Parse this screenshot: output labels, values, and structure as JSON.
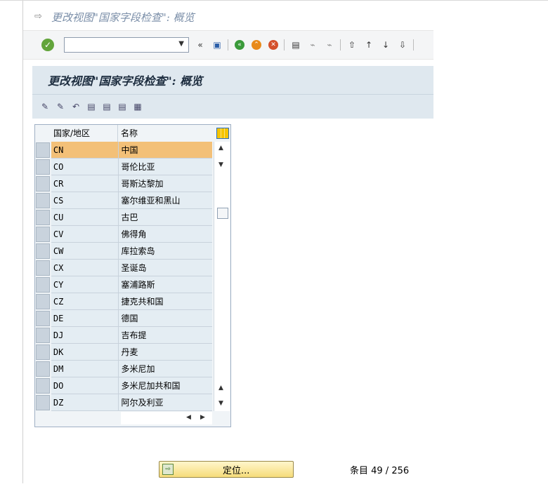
{
  "window": {
    "title": "更改视图\"国家字段检查\": 概览"
  },
  "toolbar": {
    "command_value": ""
  },
  "header": {
    "title": "更改视图\"国家字段检查\": 概览"
  },
  "table": {
    "columns": [
      "国家/地区",
      "名称"
    ],
    "rows": [
      {
        "code": "CN",
        "name": "中国"
      },
      {
        "code": "CO",
        "name": "哥伦比亚"
      },
      {
        "code": "CR",
        "name": "哥斯达黎加"
      },
      {
        "code": "CS",
        "name": "塞尔维亚和黑山"
      },
      {
        "code": "CU",
        "name": "古巴"
      },
      {
        "code": "CV",
        "name": "佛得角"
      },
      {
        "code": "CW",
        "name": "库拉索岛"
      },
      {
        "code": "CX",
        "name": "圣诞岛"
      },
      {
        "code": "CY",
        "name": "塞浦路斯"
      },
      {
        "code": "CZ",
        "name": "捷克共和国"
      },
      {
        "code": "DE",
        "name": "德国"
      },
      {
        "code": "DJ",
        "name": "吉布提"
      },
      {
        "code": "DK",
        "name": "丹麦"
      },
      {
        "code": "DM",
        "name": "多米尼加"
      },
      {
        "code": "DO",
        "name": "多米尼加共和国"
      },
      {
        "code": "DZ",
        "name": "阿尔及利亚"
      }
    ]
  },
  "footer": {
    "position_button": "定位...",
    "entry_info": "条目 49 / 256"
  }
}
